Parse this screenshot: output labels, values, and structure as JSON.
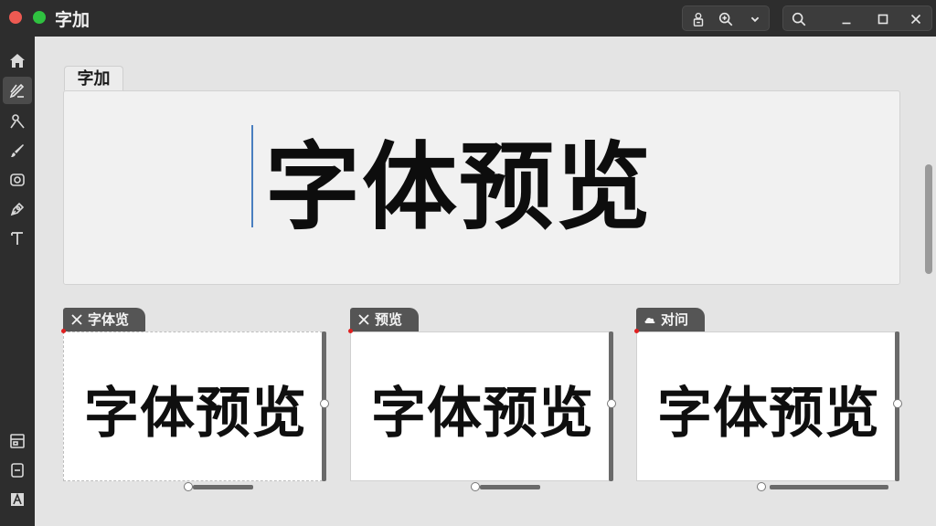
{
  "window": {
    "title": "字加"
  },
  "toolbar": {
    "icons": [
      "user-clipboard-icon",
      "zoom-icon",
      "chevron-down-icon",
      "search-icon",
      "minimize-icon",
      "maximize-icon",
      "close-icon"
    ]
  },
  "sidebar": {
    "items": [
      "home-icon",
      "pen-edit-icon",
      "tools-icon",
      "brush-icon",
      "camera-icon",
      "pen-nib-icon",
      "text-tool-icon",
      "layout-icon",
      "document-icon",
      "font-a-icon"
    ],
    "active_index": 1
  },
  "editor": {
    "tab_label": "字加",
    "preview_text": "字体预览"
  },
  "cards": [
    {
      "tab_label": "字体览",
      "tab_icon": "close-icon",
      "preview_text": "字体预览"
    },
    {
      "tab_label": "预览",
      "tab_icon": "close-icon",
      "preview_text": "字体预览"
    },
    {
      "tab_label": "对问",
      "tab_icon": "cloud-icon",
      "preview_text": "字体预览"
    }
  ],
  "colors": {
    "accent": "#4a7fc0",
    "titlebar": "#2d2d2d",
    "canvas": "#e4e4e4"
  }
}
